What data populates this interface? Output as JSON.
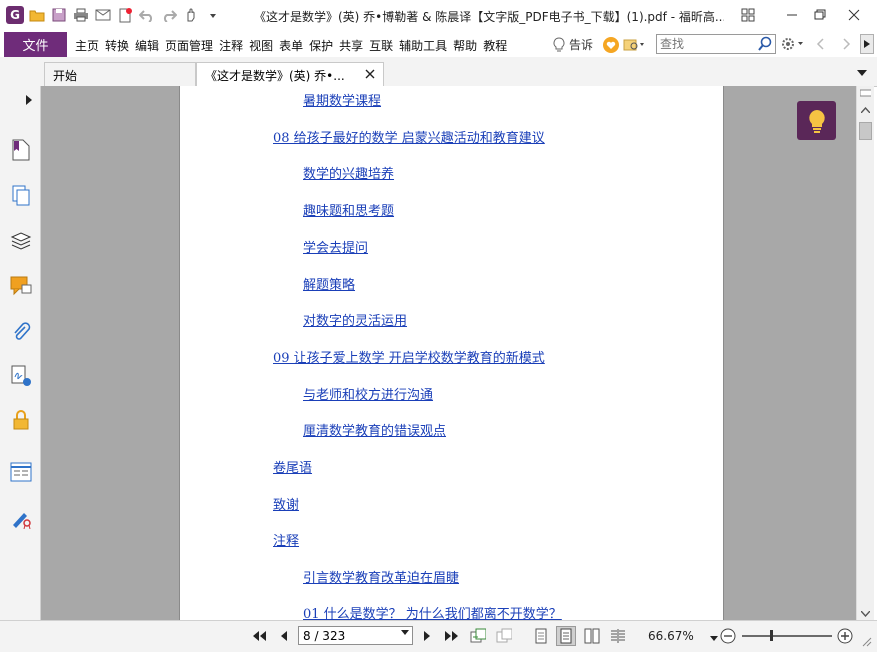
{
  "window": {
    "title": "《这才是数学》(英) 乔•博勒著 & 陈晨译【文字版_PDF电子书_下载】(1).pdf - 福昕高..."
  },
  "qat": {
    "icons": [
      "app-logo-icon",
      "open-icon",
      "save-icon",
      "print-icon",
      "email-icon",
      "new-icon",
      "undo-icon",
      "redo-icon",
      "hand-tool-icon",
      "customize-icon"
    ],
    "logo_letter": "G"
  },
  "menu": {
    "file_label": "文件",
    "items": [
      "主页",
      "转换",
      "编辑",
      "页面管理",
      "注释",
      "视图",
      "表单",
      "保护",
      "共享",
      "互联",
      "辅助工具",
      "帮助",
      "教程"
    ],
    "tellme_label": "告诉",
    "search_placeholder": "查找"
  },
  "tabs": [
    {
      "label": "开始"
    },
    {
      "label": "《这才是数学》(英) 乔•...",
      "closable": true
    }
  ],
  "toc": [
    {
      "text": "暑期数学课程",
      "level": 2
    },
    {
      "text": "08 给孩子最好的数学 启蒙兴趣活动和教育建议",
      "level": 1
    },
    {
      "text": "数学的兴趣培养",
      "level": 2
    },
    {
      "text": "趣味题和思考题",
      "level": 2
    },
    {
      "text": "学会去提问",
      "level": 2
    },
    {
      "text": "解题策略",
      "level": 2
    },
    {
      "text": "对数字的灵活运用",
      "level": 2
    },
    {
      "text": "09 让孩子爱上数学 开启学校数学教育的新模式",
      "level": 1
    },
    {
      "text": "与老师和校方进行沟通",
      "level": 2
    },
    {
      "text": "厘清数学教育的错误观点",
      "level": 2
    },
    {
      "text": "卷尾语",
      "level": 1
    },
    {
      "text": "致谢",
      "level": 1
    },
    {
      "text": "注释",
      "level": 1
    },
    {
      "text": "引言数学教育改革迫在眉睫",
      "level": 2
    },
    {
      "text": "01 什么是数学？ 为什么我们都离不开数学？",
      "level": 2
    }
  ],
  "status": {
    "page_indicator": "8 / 323",
    "zoom": "66.67%"
  },
  "colors": {
    "accent": "#6f2c7a",
    "link": "#1a3fb8",
    "canvas": "#a8a8a8"
  }
}
